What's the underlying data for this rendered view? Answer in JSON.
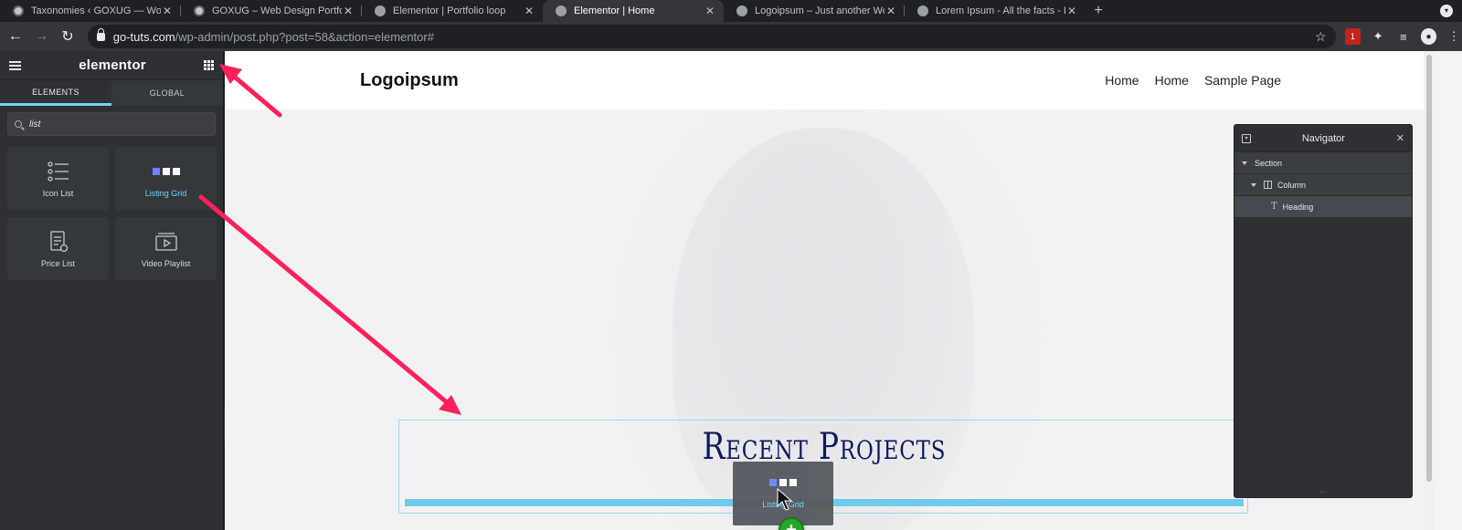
{
  "browser": {
    "tabs": [
      {
        "title": "Taxonomies ‹ GOXUG — WordPress",
        "active": false
      },
      {
        "title": "GOXUG – Web Design Portfolio",
        "active": false
      },
      {
        "title": "Elementor | Portfolio loop",
        "active": false
      },
      {
        "title": "Elementor | Home",
        "active": true
      },
      {
        "title": "Logoipsum – Just another WordPress site",
        "active": false
      },
      {
        "title": "Lorem Ipsum - All the facts - Lipsum",
        "active": false
      }
    ],
    "new_tab": "+",
    "url_host": "go-tuts.com",
    "url_path": "/wp-admin/post.php?post=58&action=elementor#",
    "extension_badge": "1"
  },
  "panel": {
    "brand": "elementor",
    "tabs": [
      "ELEMENTS",
      "GLOBAL"
    ],
    "search_value": "list",
    "widgets": [
      {
        "label": "Icon List",
        "icon": "icon-list-icon"
      },
      {
        "label": "Listing Grid",
        "icon": "listing-grid-icon"
      },
      {
        "label": "Price List",
        "icon": "price-list-icon"
      },
      {
        "label": "Video Playlist",
        "icon": "video-playlist-icon"
      }
    ]
  },
  "site": {
    "logo": "Logoipsum",
    "nav": [
      "Home",
      "Home",
      "Sample Page"
    ],
    "heading": "Recent Projects",
    "drag_label": "Listing Grid"
  },
  "navigator": {
    "title": "Navigator",
    "items": [
      {
        "label": "Section",
        "type": "section"
      },
      {
        "label": "Column",
        "type": "column"
      },
      {
        "label": "Heading",
        "type": "heading"
      }
    ],
    "footer": "…"
  },
  "colors": {
    "accent": "#71d7f7",
    "annotation_arrow": "#ff1f5a",
    "heading_color": "#0d1b5c"
  }
}
